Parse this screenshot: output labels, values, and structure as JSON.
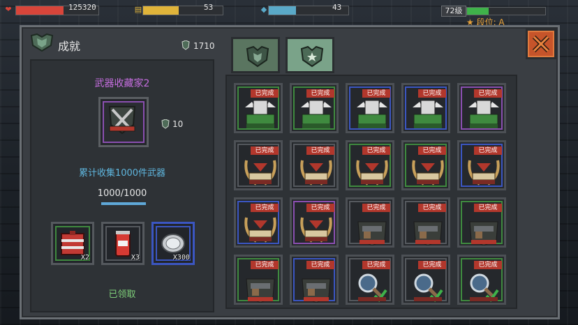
{
  "hud": {
    "hp_value": "125320",
    "hp_fill": 0.58,
    "energy_value": "53",
    "energy_fill": 0.45,
    "mana_value": "43",
    "mana_fill": 0.34,
    "level": "72级",
    "xp_fill": 0.28,
    "rank": "段位: A",
    "colors": {
      "hp": "#d8453a",
      "energy": "#e0b43a",
      "mana": "#5aa9c8",
      "xp": "#3fb24a"
    }
  },
  "panel": {
    "title": "成就",
    "currency": "1710",
    "tabs": [
      {
        "name": "tab-achievements-1",
        "icon": "shield-emblem-icon"
      },
      {
        "name": "tab-achievements-2",
        "icon": "shield-star-icon"
      }
    ],
    "close_icon": "close-icon"
  },
  "detail": {
    "name": "武器收藏家2",
    "reward": "10",
    "description": "累计收集1000件武器",
    "progress": "1000/1000",
    "progress_fill": 1.0,
    "items": [
      {
        "icon": "red-crate-icon",
        "qty": "X2",
        "border": "#3f8a3f"
      },
      {
        "icon": "soda-can-icon",
        "qty": "X3",
        "border": "#55595e"
      },
      {
        "icon": "silver-coin-icon",
        "qty": "X300",
        "border": "#3b56c2"
      }
    ],
    "status": "已领取"
  },
  "grid": {
    "badge": "已完成",
    "rows": [
      [
        {
          "icon": "winged-trophy-icon",
          "border": "#3f8a3f"
        },
        {
          "icon": "winged-trophy-icon",
          "border": "#3f8a3f"
        },
        {
          "icon": "winged-trophy-icon",
          "border": "#3b56c2"
        },
        {
          "icon": "winged-trophy-icon",
          "border": "#3b56c2"
        },
        {
          "icon": "winged-trophy-icon",
          "border": "#8a4fb0"
        }
      ],
      [
        {
          "icon": "laurel-badge-icon",
          "border": "#55595e"
        },
        {
          "icon": "laurel-badge-icon",
          "border": "#55595e"
        },
        {
          "icon": "laurel-badge-icon",
          "border": "#3f8a3f"
        },
        {
          "icon": "laurel-badge-icon",
          "border": "#3f8a3f"
        },
        {
          "icon": "laurel-badge-icon",
          "border": "#3b56c2"
        }
      ],
      [
        {
          "icon": "laurel-badge-icon",
          "border": "#3b56c2"
        },
        {
          "icon": "laurel-badge-icon",
          "border": "#8a4fb0"
        },
        {
          "icon": "gun-badge-icon",
          "border": "#55595e"
        },
        {
          "icon": "gun-badge-icon",
          "border": "#55595e"
        },
        {
          "icon": "gun-badge-icon",
          "border": "#3f8a3f"
        }
      ],
      [
        {
          "icon": "gun-badge-icon",
          "border": "#3f8a3f"
        },
        {
          "icon": "gun-badge-icon",
          "border": "#3b56c2"
        },
        {
          "icon": "magnifier-badge-icon",
          "border": "#55595e"
        },
        {
          "icon": "magnifier-badge-icon",
          "border": "#55595e"
        },
        {
          "icon": "magnifier-badge-icon",
          "border": "#3f8a3f"
        }
      ]
    ]
  }
}
